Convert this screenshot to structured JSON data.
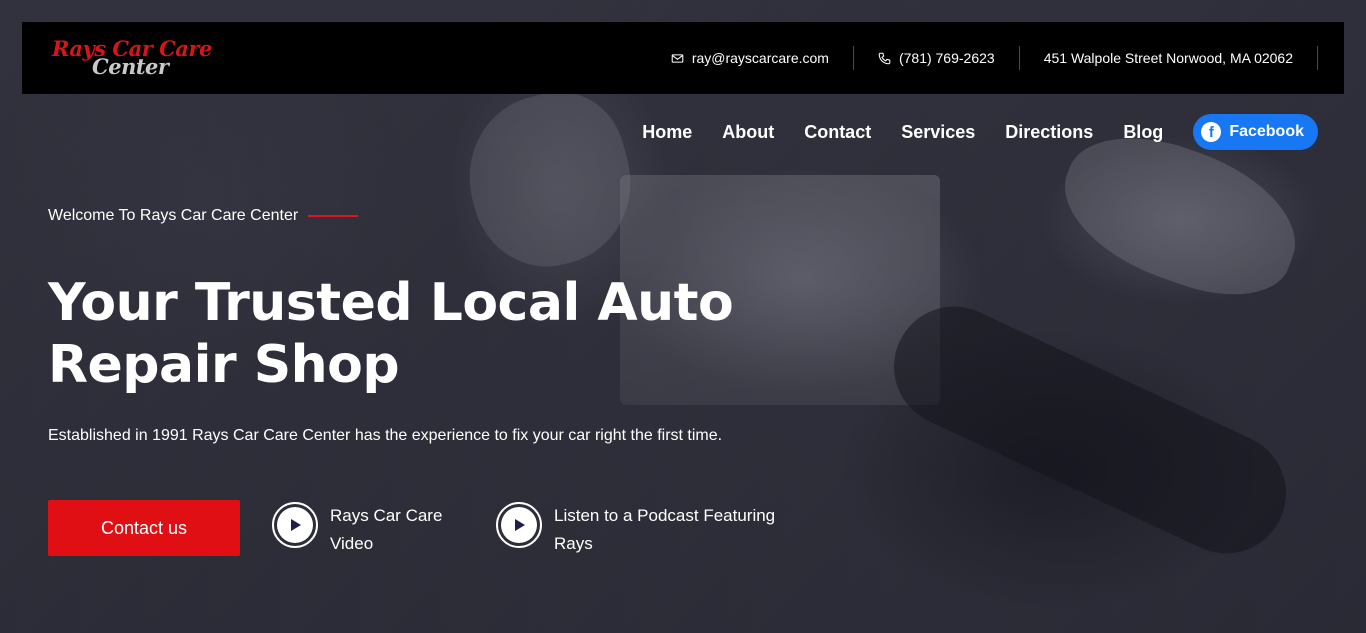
{
  "brand": {
    "logo_line1": "Rays Car Care",
    "logo_line2": "Center",
    "primary_color": "#df0f14",
    "facebook_color": "#1877f2"
  },
  "topbar": {
    "email": "ray@rayscarcare.com",
    "phone": "(781) 769-2623",
    "address": "451 Walpole Street Norwood, MA 02062"
  },
  "nav": {
    "items": [
      {
        "label": "Home"
      },
      {
        "label": "About"
      },
      {
        "label": "Contact"
      },
      {
        "label": "Services"
      },
      {
        "label": "Directions"
      },
      {
        "label": "Blog"
      }
    ],
    "facebook_label": "Facebook"
  },
  "hero": {
    "eyebrow": "Welcome To Rays Car Care Center",
    "headline_line1": "Your Trusted Local Auto",
    "headline_line2": "Repair Shop",
    "subtext": "Established in 1991 Rays Car Care Center has the experience to fix your car right the first time.",
    "cta_label": "Contact us",
    "media": [
      {
        "line1": "Rays Car Care",
        "line2": "Video",
        "icon": "play-icon"
      },
      {
        "line1": "Listen to a Podcast Featuring",
        "line2": "Rays",
        "icon": "play-icon"
      }
    ]
  }
}
